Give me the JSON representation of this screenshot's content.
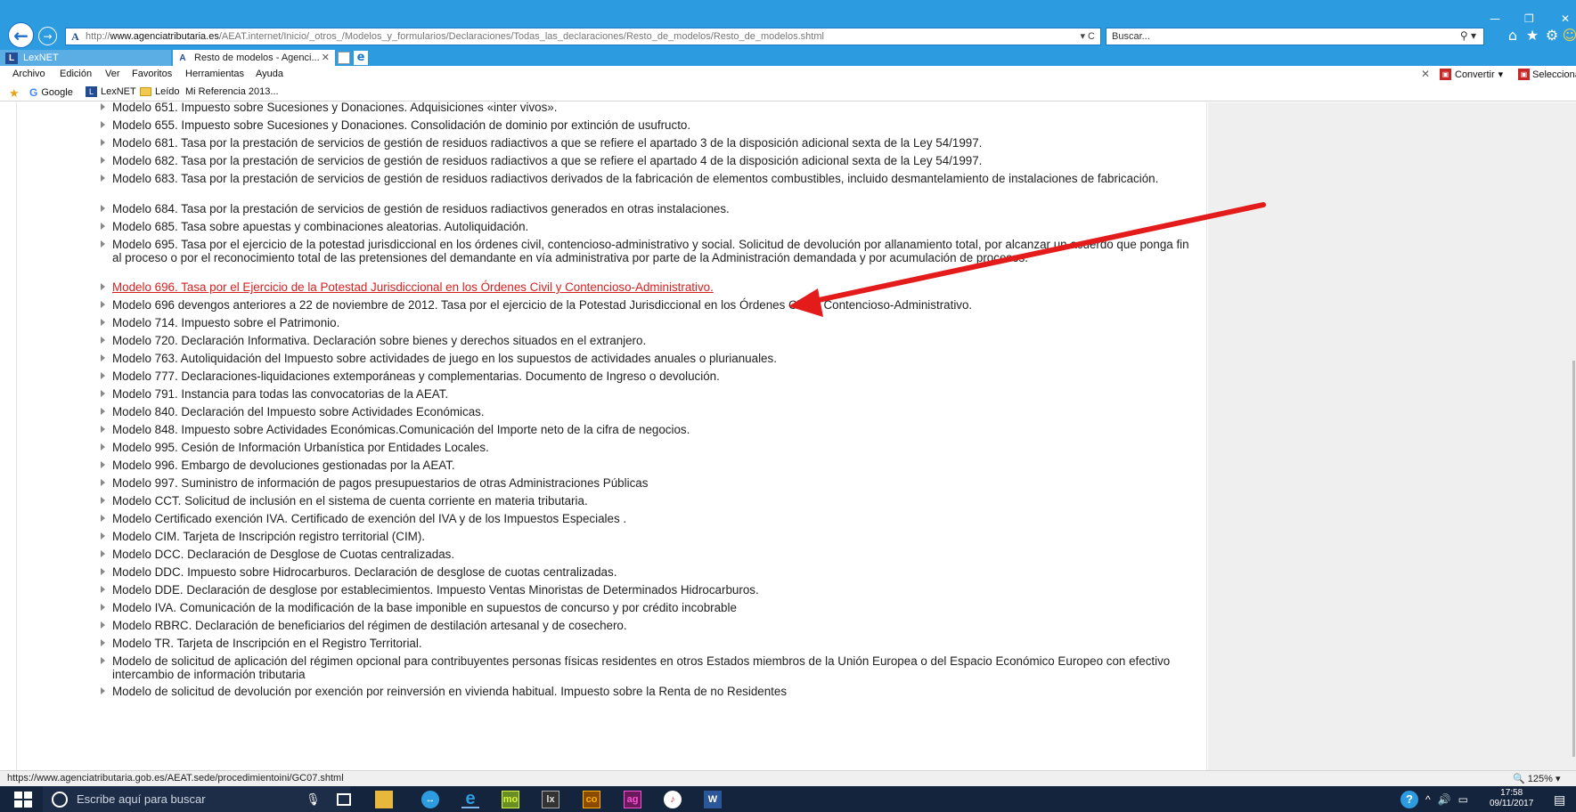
{
  "browser": {
    "url_host": "www.agenciatributaria.es",
    "url_prefix": "http://",
    "url_path": "/AEAT.internet/Inicio/_otros_/Modelos_y_formularios/Declaraciones/Todas_las_declaraciones/Resto_de_modelos/Resto_de_modelos.shtml",
    "url_controls": "▾ C",
    "search_placeholder": "Buscar...",
    "search_controls": "⚲ ▾"
  },
  "tabs": [
    {
      "label": "LexNET",
      "icon": "lexnet-icon"
    },
    {
      "label": "Resto de modelos - Agenci...",
      "icon": "aeat-icon"
    }
  ],
  "menu": [
    "Archivo",
    "Edición",
    "Ver",
    "Favoritos",
    "Herramientas",
    "Ayuda"
  ],
  "menu_right": {
    "convert": "Convertir",
    "select": "Seleccionar"
  },
  "favorites": [
    {
      "label": "Google",
      "icon": "google-icon"
    },
    {
      "label": "LexNET",
      "icon": "lexnet-icon"
    },
    {
      "label": "Leído",
      "icon": "mail-icon"
    },
    {
      "label": "Mi Referencia 2013...",
      "icon": "none"
    }
  ],
  "items": [
    {
      "text": "Modelo 651. Impuesto sobre Sucesiones y Donaciones. Adquisiciones «inter vivos».",
      "link": false
    },
    {
      "text": "Modelo 655. Impuesto sobre Sucesiones y Donaciones. Consolidación de dominio por extinción de usufructo.",
      "link": false
    },
    {
      "text": "Modelo 681. Tasa por la prestación de servicios de gestión de residuos radiactivos a que se refiere el apartado 3 de la disposición adicional sexta de la Ley 54/1997.",
      "link": false
    },
    {
      "text": "Modelo 682. Tasa por la prestación de servicios de gestión de residuos radiactivos a que se refiere el apartado 4 de la disposición adicional sexta de la Ley 54/1997.",
      "link": false
    },
    {
      "text": "Modelo 683. Tasa por la prestación de servicios de gestión de residuos radiactivos derivados de la fabricación de elementos combustibles, incluido desmantelamiento de instalaciones de fabricación.",
      "link": false
    },
    {
      "text": "Modelo 684. Tasa por la prestación de servicios de gestión de residuos radiactivos generados en otras instalaciones.",
      "link": false
    },
    {
      "text": "Modelo 685. Tasa sobre apuestas y combinaciones aleatorias. Autoliquidación.",
      "link": false
    },
    {
      "text": "Modelo 695. Tasa por el ejercicio de la potestad jurisdiccional en los órdenes civil, contencioso-administrativo y social. Solicitud de devolución por allanamiento total, por alcanzar un acuerdo que ponga fin al proceso o por el reconocimiento total de las pretensiones del demandante en vía administrativa por parte de la Administración demandada y por acumulación de procesos.",
      "link": false
    },
    {
      "text": "Modelo 696. Tasa por el Ejercicio de la Potestad Jurisdiccional en los Órdenes Civil y Contencioso-Administrativo.",
      "link": true
    },
    {
      "text": "Modelo 696 devengos anteriores a 22 de noviembre de 2012. Tasa por el ejercicio de la Potestad Jurisdiccional en los Órdenes Civil y Contencioso-Administrativo.",
      "link": false
    },
    {
      "text": "Modelo 714. Impuesto sobre el Patrimonio.",
      "link": false
    },
    {
      "text": "Modelo 720. Declaración Informativa. Declaración sobre bienes y derechos situados en el extranjero.",
      "link": false
    },
    {
      "text": "Modelo 763. Autoliquidación del Impuesto sobre actividades de juego en los supuestos de actividades anuales o plurianuales.",
      "link": false
    },
    {
      "text": "Modelo 777. Declaraciones-liquidaciones extemporáneas y complementarias. Documento de Ingreso o devolución.",
      "link": false
    },
    {
      "text": "Modelo 791. Instancia para todas las convocatorias de la AEAT.",
      "link": false
    },
    {
      "text": "Modelo 840. Declaración del Impuesto sobre Actividades Económicas.",
      "link": false
    },
    {
      "text": "Modelo 848. Impuesto sobre Actividades Económicas.Comunicación del Importe neto de la cifra de negocios.",
      "link": false
    },
    {
      "text": "Modelo 995. Cesión de Información Urbanística por Entidades Locales.",
      "link": false
    },
    {
      "text": "Modelo 996. Embargo de devoluciones gestionadas por la AEAT.",
      "link": false
    },
    {
      "text": "Modelo 997. Suministro de información de pagos presupuestarios de otras Administraciones Públicas",
      "link": false
    },
    {
      "text": "Modelo CCT. Solicitud de inclusión en el sistema de cuenta corriente en materia tributaria.",
      "link": false
    },
    {
      "text": "Modelo Certificado exención IVA. Certificado de exención del IVA y de los Impuestos Especiales .",
      "link": false
    },
    {
      "text": "Modelo CIM. Tarjeta de Inscripción registro territorial (CIM).",
      "link": false
    },
    {
      "text": "Modelo DCC. Declaración de Desglose de Cuotas centralizadas.",
      "link": false
    },
    {
      "text": "Modelo DDC. Impuesto sobre Hidrocarburos. Declaración de desglose de cuotas centralizadas.",
      "link": false
    },
    {
      "text": "Modelo DDE. Declaración de desglose por establecimientos. Impuesto Ventas Minoristas de Determinados Hidrocarburos.",
      "link": false
    },
    {
      "text": "Modelo IVA. Comunicación de la modificación de la base imponible en supuestos de concurso y por crédito incobrable",
      "link": false
    },
    {
      "text": "Modelo RBRC. Declaración de beneficiarios del régimen de destilación artesanal y de cosechero.",
      "link": false
    },
    {
      "text": "Modelo TR. Tarjeta de Inscripción en el Registro Territorial.",
      "link": false
    },
    {
      "text": "Modelo de solicitud de aplicación del régimen opcional para contribuyentes personas físicas residentes en otros Estados miembros de la Unión Europea o del Espacio Económico Europeo con efectivo intercambio de información tributaria",
      "link": false
    },
    {
      "text": "Modelo de solicitud de devolución por exención por reinversión en vivienda habitual. Impuesto sobre la Renta de no Residentes",
      "link": false
    }
  ],
  "status": {
    "url": "https://www.agenciatributaria.gob.es/AEAT.sede/procedimientoini/GC07.shtml",
    "zoom": "125%"
  },
  "taskbar": {
    "search_placeholder": "Escribe aquí para buscar",
    "apps": [
      "mo",
      "lx",
      "co",
      "ag"
    ],
    "time": "17:58",
    "date": "09/11/2017"
  },
  "colors": {
    "accent": "#2d9be0",
    "link": "#d81f1f",
    "arrow": "#e31b1b"
  }
}
